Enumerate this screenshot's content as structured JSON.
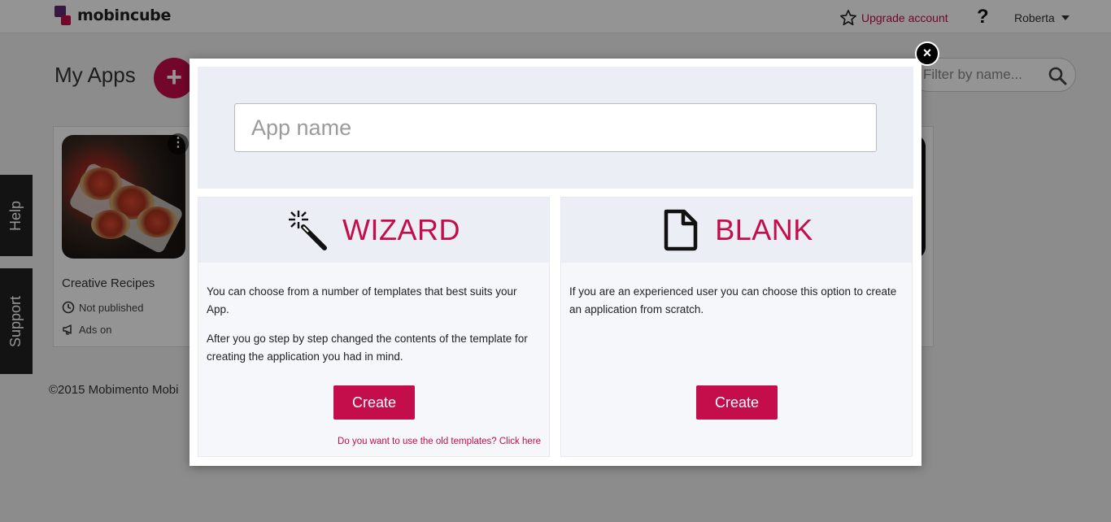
{
  "app": {
    "logo_text": "mobincube"
  },
  "header": {
    "upgrade_label": "Upgrade account",
    "help_label": "?",
    "user_name": "Roberta"
  },
  "main": {
    "title": "My Apps",
    "add_label": "+",
    "filter_placeholder": "Filter by name...",
    "apps": [
      {
        "title": "Creative Recipes",
        "status": "Not published",
        "ads": "Ads on"
      }
    ]
  },
  "side_tabs": {
    "help": "Help",
    "support": "Support"
  },
  "footer": {
    "copyright": "©2015 Mobimento Mobi"
  },
  "modal": {
    "close_label": "×",
    "app_name_placeholder": "App name",
    "wizard": {
      "title": "WIZARD",
      "text1": "You can choose from a number of templates that best suits your App.",
      "text2": "After you go step by step changed the contents of the template for creating the application you had in mind.",
      "create_label": "Create",
      "old_templates_link": "Do you want to use the old templates? Click here"
    },
    "blank": {
      "title": "BLANK",
      "text1": "If you are an experienced user you can choose this option to create an application from scratch.",
      "create_label": "Create"
    }
  },
  "colors": {
    "accent": "#c40d4b",
    "overlay": "rgba(0,0,0,0.42)",
    "panel": "#ebeef5"
  },
  "icons": [
    "star-icon",
    "search-icon",
    "clock-icon",
    "megaphone-icon",
    "magic-wand-icon",
    "document-icon",
    "close-icon",
    "caret-down-icon",
    "plus-icon"
  ]
}
